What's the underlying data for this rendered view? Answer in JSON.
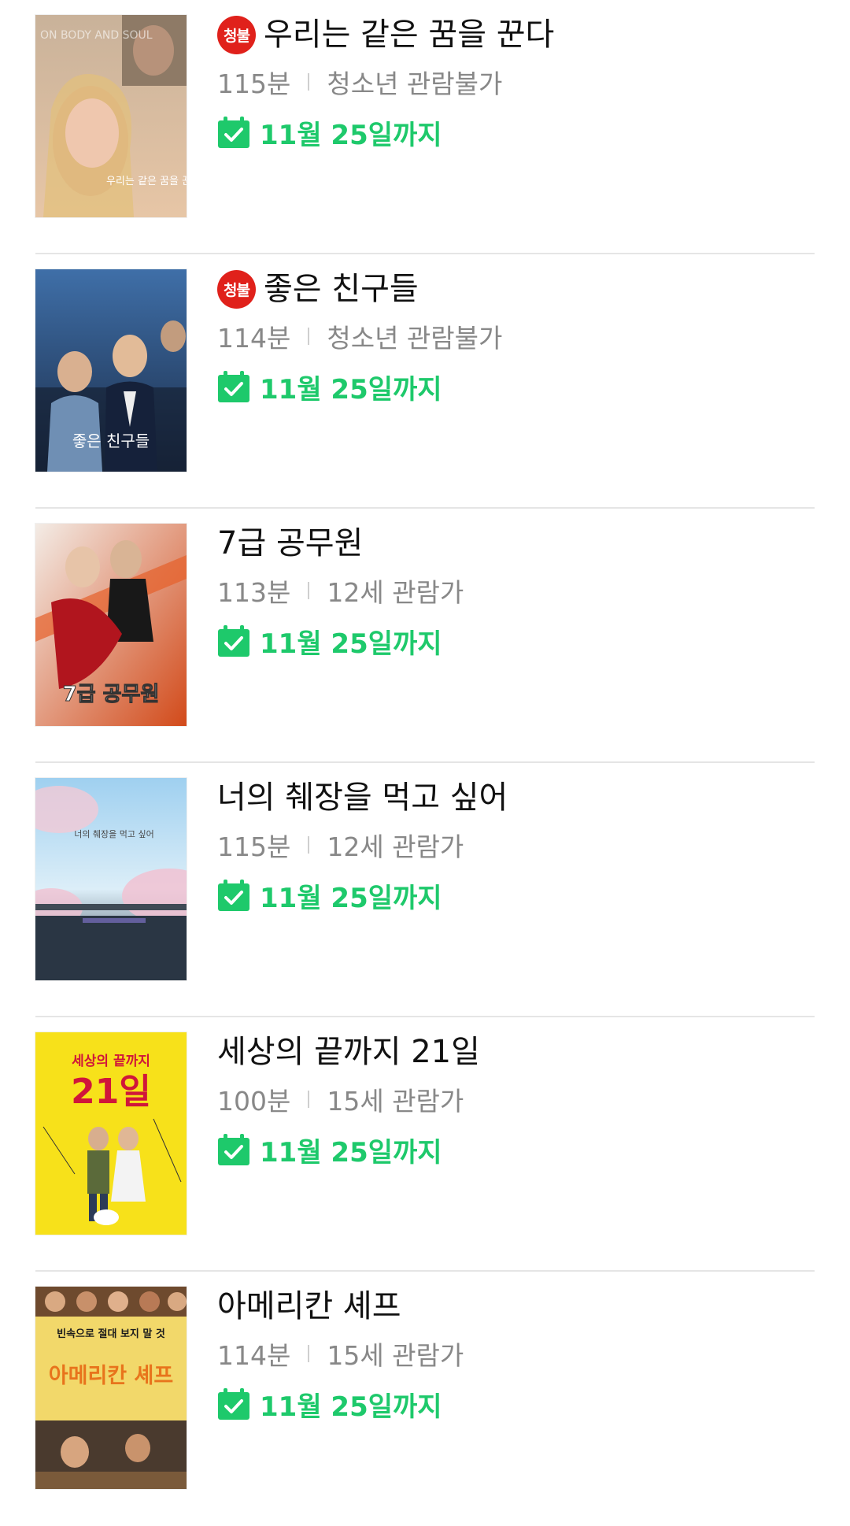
{
  "colors": {
    "accent_green": "#1ec96b",
    "badge_red": "#e0211b",
    "meta_gray": "#888888"
  },
  "movies": [
    {
      "title": "우리는 같은 꿈을 꾼다",
      "badge": "청불",
      "runtime": "115분",
      "rating": "청소년 관람불가",
      "available_until": "11월 25일까지",
      "poster_text": "우리는 같은 꿈을 꾼다",
      "poster_side_text": "ON BODY AND SOUL"
    },
    {
      "title": "좋은 친구들",
      "badge": "청불",
      "runtime": "114분",
      "rating": "청소년 관람불가",
      "available_until": "11월 25일까지",
      "poster_text": "좋은 친구들"
    },
    {
      "title": "7급 공무원",
      "badge": "",
      "runtime": "113분",
      "rating": "12세 관람가",
      "available_until": "11월 25일까지",
      "poster_text": "7급 공무원"
    },
    {
      "title": "너의 췌장을 먹고 싶어",
      "badge": "",
      "runtime": "115분",
      "rating": "12세 관람가",
      "available_until": "11월 25일까지",
      "poster_text": "너의 췌장을 먹고 싶어"
    },
    {
      "title": "세상의 끝까지 21일",
      "badge": "",
      "runtime": "100분",
      "rating": "15세 관람가",
      "available_until": "11월 25일까지",
      "poster_text": "세상의 끝까지",
      "poster_text2": "21일"
    },
    {
      "title": "아메리칸 셰프",
      "badge": "",
      "runtime": "114분",
      "rating": "15세 관람가",
      "available_until": "11월 25일까지",
      "poster_text": "아메리칸 셰프",
      "poster_tagline": "빈속으로 절대 보지 말 것"
    }
  ],
  "icons": {
    "badge": "adult-only-badge",
    "availability": "calendar-check-icon"
  }
}
